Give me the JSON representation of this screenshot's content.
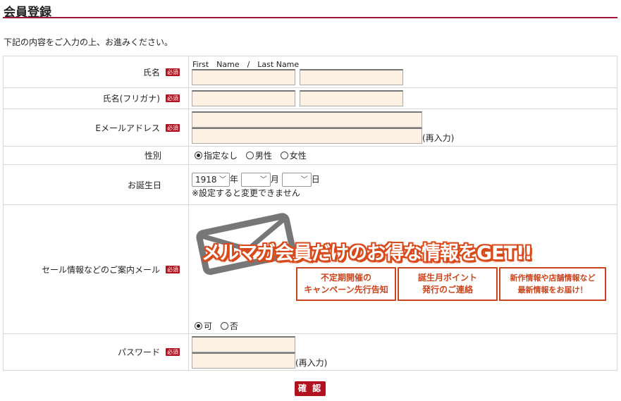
{
  "page": {
    "title": "会員登録",
    "intro": "下記の内容をご入力の上、お進みください。"
  },
  "required_label": "必須",
  "name": {
    "label": "氏名",
    "hint": "First　Name　/　Last Name"
  },
  "furigana": {
    "label": "氏名(フリガナ)"
  },
  "email": {
    "label": "Eメールアドレス",
    "reenter": "(再入力)"
  },
  "gender": {
    "label": "性別",
    "options": [
      "指定なし",
      "男性",
      "女性"
    ],
    "selected": "指定なし"
  },
  "birthday": {
    "label": "お誕生日",
    "year_value": "1918",
    "year_unit": "年",
    "month_value": "",
    "month_unit": "月",
    "day_value": "",
    "day_unit": "日",
    "note": "※設定すると変更できません"
  },
  "newsletter": {
    "label": "セール情報などのご案内メール",
    "banner": "メルマガ会員だけのお得な情報をGET!!",
    "benefits": [
      {
        "line1": "不定期開催の",
        "line2": "キャンペーン先行告知"
      },
      {
        "line1": "誕生月ポイント",
        "line2": "発行のご連絡"
      },
      {
        "line1": "新作情報や店舗情報など",
        "line2": "最新情報をお届け！"
      }
    ],
    "options": [
      "可",
      "否"
    ],
    "selected": "可"
  },
  "password": {
    "label": "パスワード",
    "reenter": "(再入力)"
  },
  "confirm_label": "確 認",
  "colors": {
    "accent": "#a0173b",
    "required": "#b0121f",
    "benefit": "#c8461f",
    "input_bg": "#fdf1e3"
  }
}
